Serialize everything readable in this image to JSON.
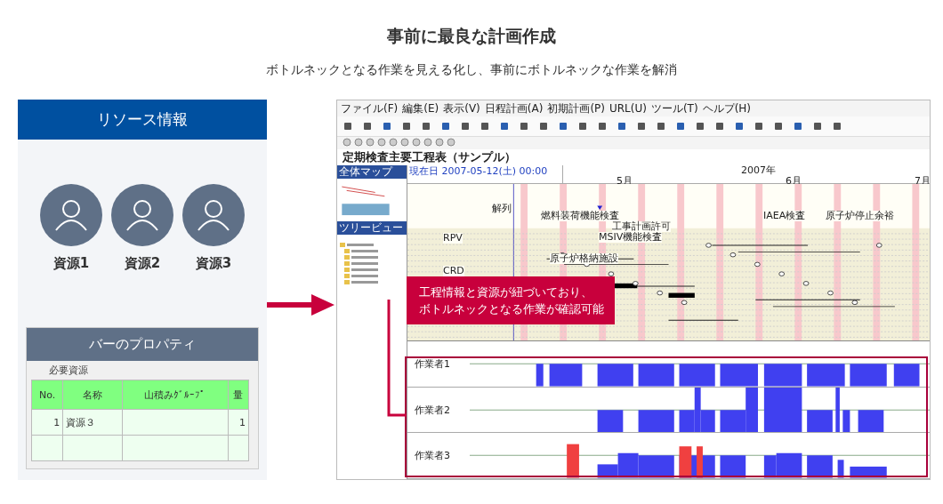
{
  "heading": "事前に最良な計画作成",
  "subheading": "ボトルネックとなる作業を見える化し、事前にボトルネックな作業を解消",
  "resource_panel": {
    "title": "リソース情報",
    "resources": [
      {
        "label": "資源1"
      },
      {
        "label": "資源2"
      },
      {
        "label": "資源3"
      }
    ]
  },
  "bar_properties": {
    "title": "バーのプロパティ",
    "section": "必要資源",
    "columns": [
      "No.",
      "名称",
      "山積みｸﾞﾙｰﾌﾟ",
      "量"
    ],
    "rows": [
      [
        "1",
        "資源３",
        "",
        "1"
      ]
    ]
  },
  "app": {
    "menu": [
      "ファイル(F)",
      "編集(E)",
      "表示(V)",
      "日程計画(A)",
      "初期計画(P)",
      "URL(U)",
      "ツール(T)",
      "ヘルプ(H)"
    ],
    "title": "定期検査主要工程表（サンプル）",
    "side_panes": [
      "全体マップ",
      "ツリービュー"
    ],
    "current_date": "現在日 2007-05-12(土) 00:00",
    "year": "2007年",
    "months": [
      "5月",
      "6月",
      "7月"
    ],
    "row_labels": [
      "RPV",
      "CRD"
    ],
    "events": [
      "解列",
      "燃料装荷機能検査",
      "IAEA検査",
      "原子炉停止余裕",
      "工事計画許可",
      "MSIV機能検査",
      "原子炉格納施設"
    ],
    "workers": [
      {
        "name": "作業者1"
      },
      {
        "name": "作業者2"
      },
      {
        "name": "作業者3"
      }
    ]
  },
  "callout": [
    "工程情報と資源が紐づいており、",
    "ボトルネックとなる作業が確認可能"
  ]
}
